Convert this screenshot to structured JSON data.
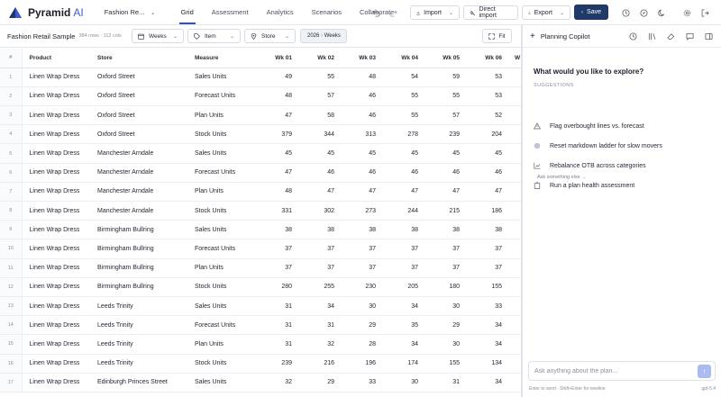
{
  "app": {
    "name": "Pyramid",
    "name_suffix": "AI",
    "doc_title": "Fashion Re..."
  },
  "tabs": [
    {
      "label": "Grid",
      "active": true
    },
    {
      "label": "Assessment"
    },
    {
      "label": "Analytics"
    },
    {
      "label": "Scenarios"
    },
    {
      "label": "Collaborate"
    }
  ],
  "toolbar": {
    "import_label": "Import",
    "direct_import_label": "Direct import",
    "export_label": "Export",
    "save_label": "Save"
  },
  "sheet": {
    "name": "Fashion Retail Sample",
    "meta": "384 rows · 112 cols"
  },
  "controls": {
    "time_label": "Weeks",
    "item_label": "Item",
    "store_label": "Store",
    "period_year": "2026",
    "period_sep": "›",
    "period_unit": "Weeks",
    "fit_label": "Fit"
  },
  "columns": {
    "idx": "#",
    "product": "Product",
    "store": "Store",
    "measure": "Measure",
    "weeks": [
      "Wk 01",
      "Wk 02",
      "Wk 03",
      "Wk 04",
      "Wk 05",
      "Wk 06",
      "W"
    ]
  },
  "rows": [
    {
      "i": "1",
      "product": "Linen Wrap Dress",
      "store": "Oxford Street",
      "measure": "Sales Units",
      "v": [
        "49",
        "55",
        "48",
        "54",
        "59",
        "53",
        ""
      ]
    },
    {
      "i": "2",
      "product": "Linen Wrap Dress",
      "store": "Oxford Street",
      "measure": "Forecast Units",
      "v": [
        "48",
        "57",
        "46",
        "55",
        "55",
        "53",
        ""
      ]
    },
    {
      "i": "3",
      "product": "Linen Wrap Dress",
      "store": "Oxford Street",
      "measure": "Plan Units",
      "v": [
        "47",
        "58",
        "46",
        "55",
        "57",
        "52",
        ""
      ]
    },
    {
      "i": "4",
      "product": "Linen Wrap Dress",
      "store": "Oxford Street",
      "measure": "Stock Units",
      "v": [
        "379",
        "344",
        "313",
        "278",
        "239",
        "204",
        ""
      ]
    },
    {
      "i": "5",
      "product": "Linen Wrap Dress",
      "store": "Manchester Arndale",
      "measure": "Sales Units",
      "v": [
        "45",
        "45",
        "45",
        "45",
        "45",
        "45",
        ""
      ]
    },
    {
      "i": "6",
      "product": "Linen Wrap Dress",
      "store": "Manchester Arndale",
      "measure": "Forecast Units",
      "v": [
        "47",
        "46",
        "46",
        "46",
        "46",
        "46",
        ""
      ]
    },
    {
      "i": "7",
      "product": "Linen Wrap Dress",
      "store": "Manchester Arndale",
      "measure": "Plan Units",
      "v": [
        "48",
        "47",
        "47",
        "47",
        "47",
        "47",
        ""
      ]
    },
    {
      "i": "8",
      "product": "Linen Wrap Dress",
      "store": "Manchester Arndale",
      "measure": "Stock Units",
      "v": [
        "331",
        "302",
        "273",
        "244",
        "215",
        "186",
        ""
      ]
    },
    {
      "i": "9",
      "product": "Linen Wrap Dress",
      "store": "Birmingham Bullring",
      "measure": "Sales Units",
      "v": [
        "38",
        "38",
        "38",
        "38",
        "38",
        "38",
        ""
      ]
    },
    {
      "i": "10",
      "product": "Linen Wrap Dress",
      "store": "Birmingham Bullring",
      "measure": "Forecast Units",
      "v": [
        "37",
        "37",
        "37",
        "37",
        "37",
        "37",
        ""
      ]
    },
    {
      "i": "11",
      "product": "Linen Wrap Dress",
      "store": "Birmingham Bullring",
      "measure": "Plan Units",
      "v": [
        "37",
        "37",
        "37",
        "37",
        "37",
        "37",
        ""
      ]
    },
    {
      "i": "12",
      "product": "Linen Wrap Dress",
      "store": "Birmingham Bullring",
      "measure": "Stock Units",
      "v": [
        "280",
        "255",
        "230",
        "205",
        "180",
        "155",
        ""
      ]
    },
    {
      "i": "13",
      "product": "Linen Wrap Dress",
      "store": "Leeds Trinity",
      "measure": "Sales Units",
      "v": [
        "31",
        "34",
        "30",
        "34",
        "30",
        "33",
        ""
      ]
    },
    {
      "i": "14",
      "product": "Linen Wrap Dress",
      "store": "Leeds Trinity",
      "measure": "Forecast Units",
      "v": [
        "31",
        "31",
        "29",
        "35",
        "29",
        "34",
        ""
      ]
    },
    {
      "i": "15",
      "product": "Linen Wrap Dress",
      "store": "Leeds Trinity",
      "measure": "Plan Units",
      "v": [
        "31",
        "32",
        "28",
        "34",
        "30",
        "34",
        ""
      ]
    },
    {
      "i": "16",
      "product": "Linen Wrap Dress",
      "store": "Leeds Trinity",
      "measure": "Stock Units",
      "v": [
        "239",
        "216",
        "196",
        "174",
        "155",
        "134",
        ""
      ]
    },
    {
      "i": "17",
      "product": "Linen Wrap Dress",
      "store": "Edinburgh Princes Street",
      "measure": "Sales Units",
      "v": [
        "32",
        "29",
        "33",
        "30",
        "31",
        "34",
        ""
      ]
    }
  ],
  "copilot": {
    "title": "Planning Copilot",
    "question": "What would you like to explore?",
    "suggestions_label": "SUGGESTIONS",
    "suggestions": [
      {
        "label": "Flag overbought lines vs. forecast",
        "icon": "warning-icon"
      },
      {
        "label": "Reset markdown ladder for slow movers",
        "icon": "dot-icon"
      },
      {
        "label": "Rebalance OTB across categories",
        "icon": "chart-icon"
      },
      {
        "label": "Run a plan health assessment",
        "icon": "clipboard-icon"
      }
    ],
    "ask_else": "Ask something else →",
    "input_placeholder": "Ask anything about the plan...",
    "hint": "Enter to send · Shift+Enter for newline",
    "model": "gpt-5.4"
  }
}
